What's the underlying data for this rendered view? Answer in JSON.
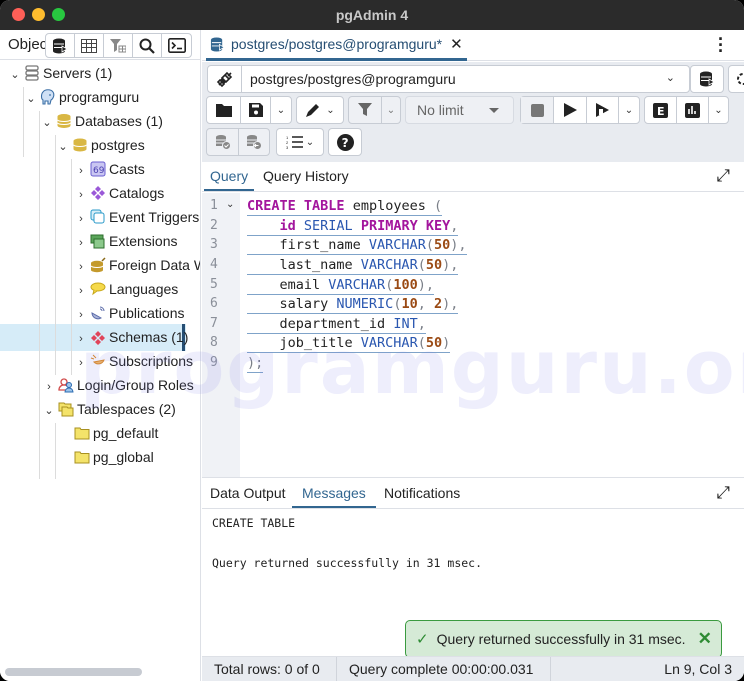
{
  "window": {
    "title": "pgAdmin 4"
  },
  "object_explorer": {
    "label": "Object Explorer",
    "toolbar": [
      "query-tool-icon",
      "view-data-icon",
      "filter-rows-icon",
      "search-icon",
      "psql-terminal-icon"
    ],
    "tree": [
      {
        "label": "Servers (1)",
        "icon": "servers-icon",
        "expanded": true,
        "level": 0
      },
      {
        "label": "programguru",
        "icon": "postgres-elephant-icon",
        "expanded": true,
        "level": 1
      },
      {
        "label": "Databases (1)",
        "icon": "databases-icon",
        "expanded": true,
        "level": 2
      },
      {
        "label": "postgres",
        "icon": "database-icon",
        "expanded": true,
        "level": 3
      },
      {
        "label": "Casts",
        "icon": "casts-icon",
        "expanded": false,
        "level": 4
      },
      {
        "label": "Catalogs",
        "icon": "catalogs-icon",
        "expanded": false,
        "level": 4
      },
      {
        "label": "Event Triggers",
        "icon": "event-triggers-icon",
        "expanded": false,
        "level": 4
      },
      {
        "label": "Extensions",
        "icon": "extensions-icon",
        "expanded": false,
        "level": 4
      },
      {
        "label": "Foreign Data Wrappers",
        "icon": "foreign-data-wrappers-icon",
        "expanded": false,
        "level": 4
      },
      {
        "label": "Languages",
        "icon": "languages-icon",
        "expanded": false,
        "level": 4
      },
      {
        "label": "Publications",
        "icon": "publications-icon",
        "expanded": false,
        "level": 4
      },
      {
        "label": "Schemas (1)",
        "icon": "schemas-icon",
        "expanded": false,
        "level": 4,
        "selected": true
      },
      {
        "label": "Subscriptions",
        "icon": "subscriptions-icon",
        "expanded": false,
        "level": 4
      },
      {
        "label": "Login/Group Roles",
        "icon": "login-roles-icon",
        "expanded": false,
        "level": 2
      },
      {
        "label": "Tablespaces (2)",
        "icon": "tablespaces-icon",
        "expanded": true,
        "level": 2
      },
      {
        "label": "pg_default",
        "icon": "folder-icon",
        "level": 3
      },
      {
        "label": "pg_global",
        "icon": "folder-icon",
        "level": 3
      }
    ]
  },
  "query_tool": {
    "tab_title": "postgres/postgres@programguru*",
    "connection": "postgres/postgres@programguru",
    "limit": "No limit",
    "editor_tabs": [
      "Query",
      "Query History"
    ],
    "active_editor_tab": "Query",
    "line_numbers": [
      "1",
      "2",
      "3",
      "4",
      "5",
      "6",
      "7",
      "8",
      "9"
    ],
    "code_lines": [
      "CREATE TABLE employees (",
      "    id SERIAL PRIMARY KEY,",
      "    first_name VARCHAR(50),",
      "    last_name VARCHAR(50),",
      "    email VARCHAR(100),",
      "    salary NUMERIC(10, 2),",
      "    department_id INT,",
      "    job_title VARCHAR(50)",
      ");"
    ],
    "output_tabs": [
      "Data Output",
      "Messages",
      "Notifications"
    ],
    "active_output_tab": "Messages",
    "messages": [
      "CREATE TABLE",
      "Query returned successfully in 31 msec."
    ],
    "toast": "Query returned successfully in 31 msec.",
    "status": {
      "total_rows": "Total rows: 0 of 0",
      "query_complete": "Query complete 00:00:00.031",
      "cursor": "Ln 9, Col 3"
    }
  },
  "watermark": "programguru.org",
  "colors": {
    "accent": "#326690",
    "selected_row": "#d6ecf8",
    "toast_bg": "#d5ead6",
    "toast_border": "#3a9a3f"
  }
}
